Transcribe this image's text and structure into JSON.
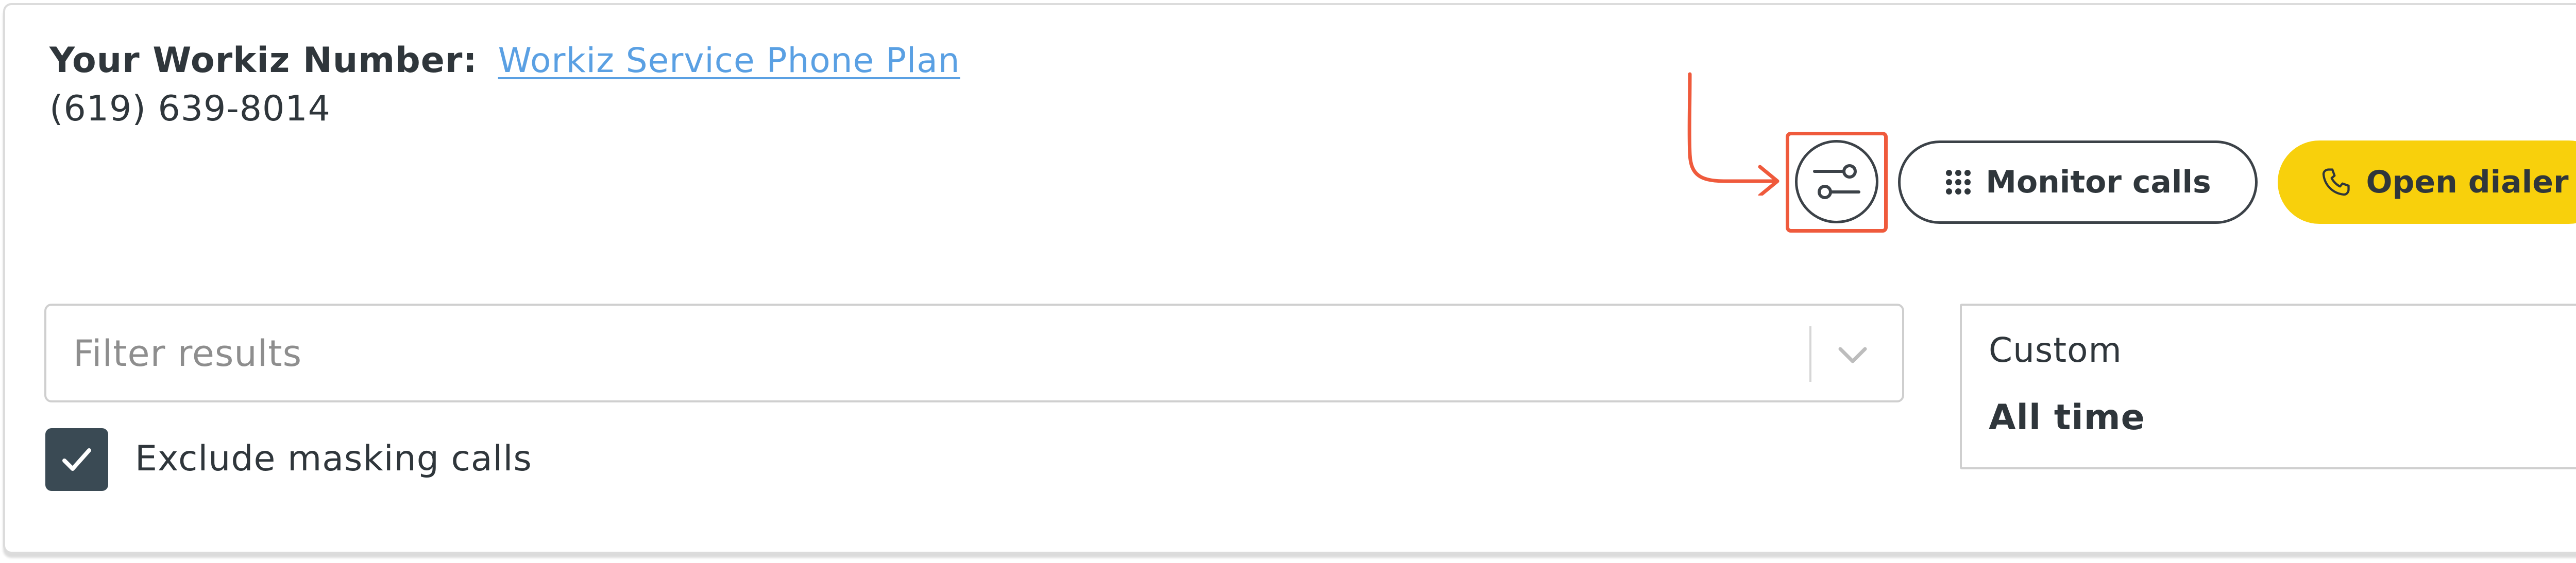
{
  "workiz_number": {
    "label": "Your Workiz Number:",
    "plan_link": "Workiz Service Phone Plan",
    "phone": "(619) 639-8014"
  },
  "actions": {
    "settings_icon": "sliders-icon",
    "monitor_label": "Monitor calls",
    "monitor_icon": "dialpad-icon",
    "dialer_label": "Open dialer",
    "dialer_icon": "phone-icon"
  },
  "filter": {
    "placeholder": "Filter results",
    "value": "",
    "chevron_icon": "chevron-down-icon"
  },
  "exclude_masking": {
    "label": "Exclude masking calls",
    "checked": true
  },
  "date_filter": {
    "range_label": "Custom",
    "value": "All time"
  },
  "colors": {
    "primary_text": "#2f363b",
    "link": "#5aa0e3",
    "dialer_bg": "#f8d00c",
    "checkbox_bg": "#3a4a54",
    "annotation": "#ef5a3c",
    "border": "#cfcfcf"
  }
}
